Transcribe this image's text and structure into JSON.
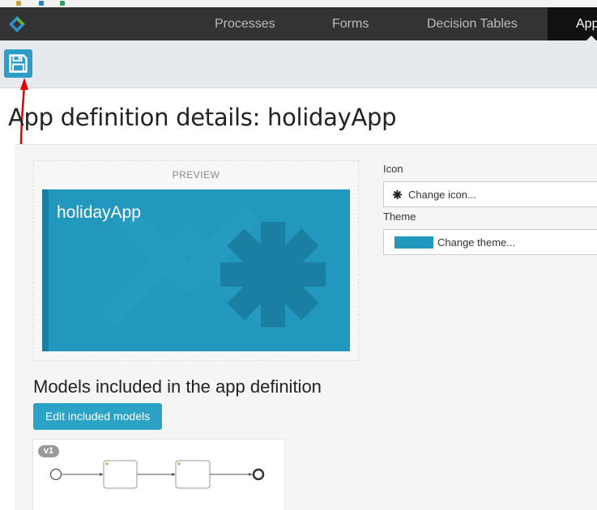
{
  "navbar": {
    "items": [
      {
        "label": "Processes"
      },
      {
        "label": "Forms"
      },
      {
        "label": "Decision Tables"
      },
      {
        "label": "Apps"
      }
    ]
  },
  "toolbar": {
    "save_icon": "floppy-disk-icon"
  },
  "page": {
    "title": "App definition details: holidayApp"
  },
  "preview": {
    "label": "PREVIEW",
    "app_name": "holidayApp",
    "theme_color": "#2398be",
    "icon": "asterisk-icon"
  },
  "icon_field": {
    "label": "Icon",
    "button_text": "Change icon..."
  },
  "theme_field": {
    "label": "Theme",
    "button_text": "Change theme..."
  },
  "models": {
    "title": "Models included in the app definition",
    "edit_button": "Edit included models",
    "cards": [
      {
        "version": "v1"
      }
    ]
  },
  "colors": {
    "navbar": "#333333",
    "accent": "#2ba3c6",
    "toolbar": "#e6e9ee"
  }
}
